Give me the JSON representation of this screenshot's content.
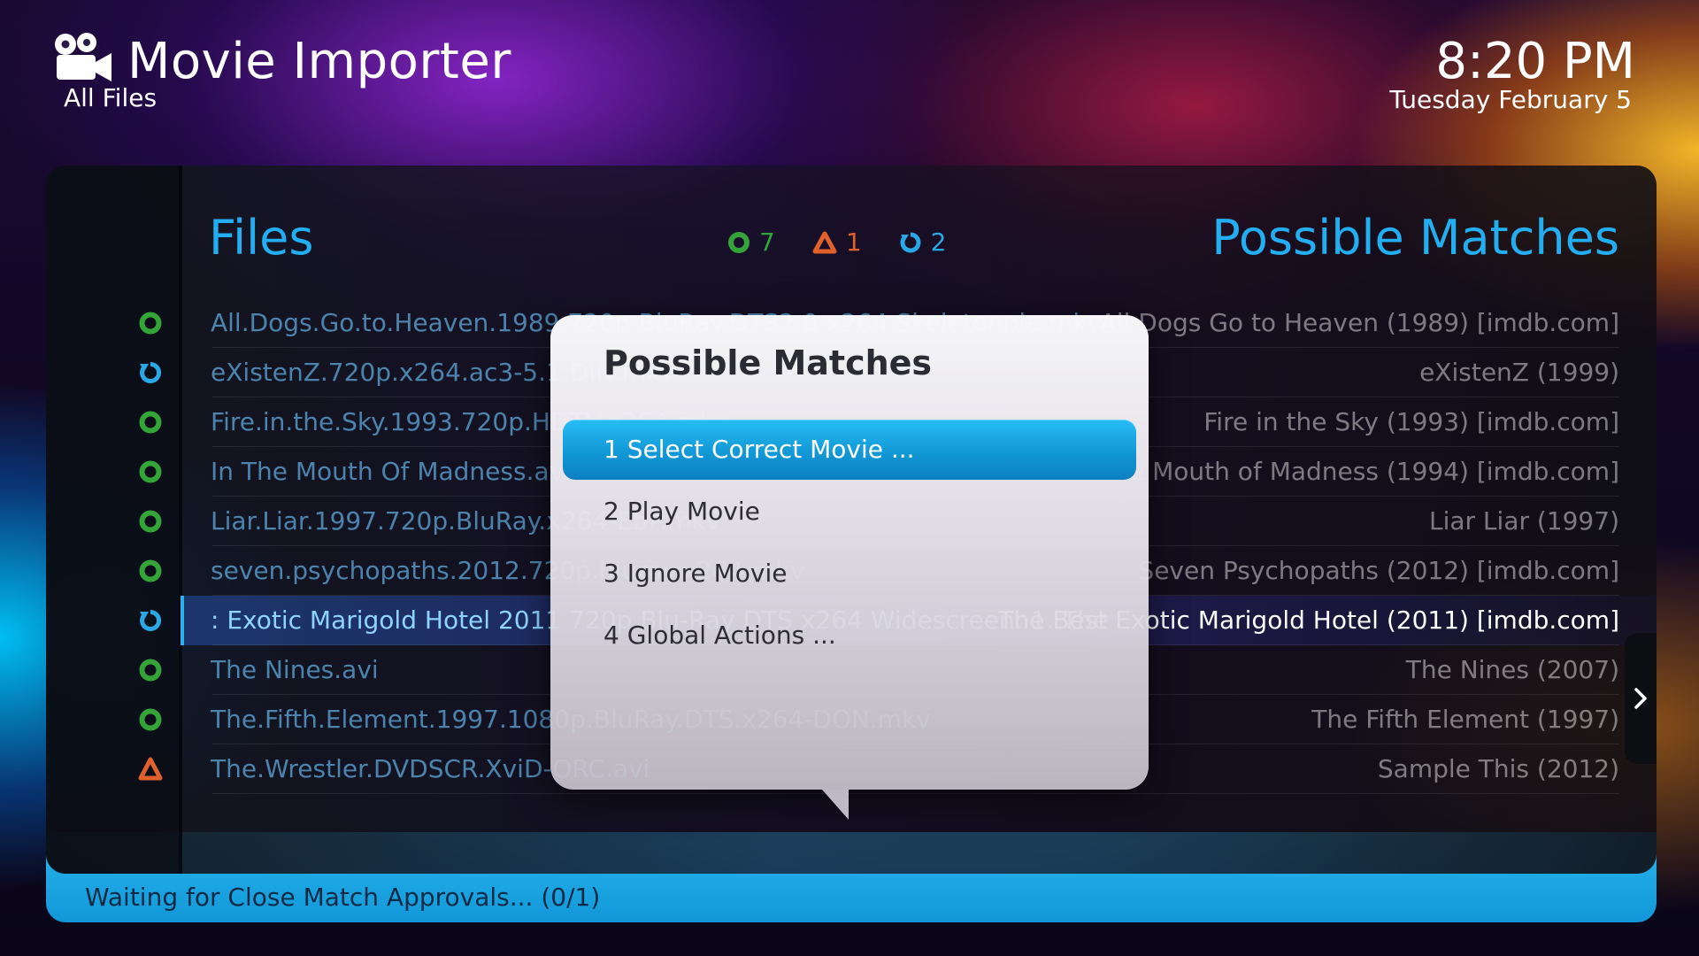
{
  "header": {
    "title": "Movie Importer",
    "subtitle": "All Files",
    "time": "8:20 PM",
    "date": "Tuesday February 5",
    "logo_icon": "movie-camera-icon"
  },
  "panel": {
    "files_heading": "Files",
    "matches_heading": "Possible Matches",
    "summary": [
      {
        "icon": "check-circle-icon",
        "count": "7",
        "color": "#33a33a"
      },
      {
        "icon": "warning-triangle-icon",
        "count": "1",
        "color": "#e0612c"
      },
      {
        "icon": "refresh-icon",
        "count": "2",
        "color": "#2aa8e6"
      }
    ],
    "rows": [
      {
        "status": "ok",
        "file": "All.Dogs.Go.to.Heaven.1989.720p.BluRay.DTS2.0.x264.Skeletonpla.mkv",
        "match": "All Dogs Go to Heaven (1989) [imdb.com]"
      },
      {
        "status": "pending",
        "file": "eXistenZ.720p.x264.ac3-5.1.DiN.mkv",
        "match": "eXistenZ (1999)"
      },
      {
        "status": "ok",
        "file": "Fire.in.the.Sky.1993.720p.HDTV.x264.mkv",
        "match": "Fire in the Sky (1993) [imdb.com]"
      },
      {
        "status": "ok",
        "file": "In The Mouth Of Madness.avi",
        "match": "In the Mouth of Madness (1994) [imdb.com]"
      },
      {
        "status": "ok",
        "file": "Liar.Liar.1997.720p.BluRay.x264-EbP.mkv",
        "match": "Liar Liar (1997)"
      },
      {
        "status": "ok",
        "file": "seven.psychopaths.2012.720p.bluray.x264.mkv",
        "match": "Seven Psychopaths (2012) [imdb.com]"
      },
      {
        "status": "pending",
        "file": ": Exotic Marigold Hotel 2011 720p Blu-Ray DTS x264 Widescreen. 1. The",
        "match": "The Best Exotic Marigold Hotel (2011) [imdb.com]",
        "selected": true
      },
      {
        "status": "ok",
        "file": "The Nines.avi",
        "match": "The Nines (2007)"
      },
      {
        "status": "ok",
        "file": "The.Fifth.Element.1997.1080p.BluRay.DTS.x264-DON.mkv",
        "match": "The Fifth Element (1997)"
      },
      {
        "status": "warn",
        "file": "The.Wrestler.DVDSCR.XviD-ORC.avi",
        "match": "Sample This (2012)"
      }
    ],
    "next_icon": "chevron-right-icon"
  },
  "dialog": {
    "title": "Possible Matches",
    "items": [
      {
        "label": "1 Select Correct Movie ...",
        "active": true
      },
      {
        "label": "2 Play Movie",
        "active": false
      },
      {
        "label": "3 Ignore Movie",
        "active": false
      },
      {
        "label": "4 Global Actions ...",
        "active": false
      }
    ]
  },
  "status_bar": {
    "text": "Waiting for Close Match Approvals... (0/1)"
  },
  "colors": {
    "accent": "#22aef0",
    "ok": "#33a33a",
    "warn": "#e0612c",
    "pending": "#2aa8e6"
  }
}
